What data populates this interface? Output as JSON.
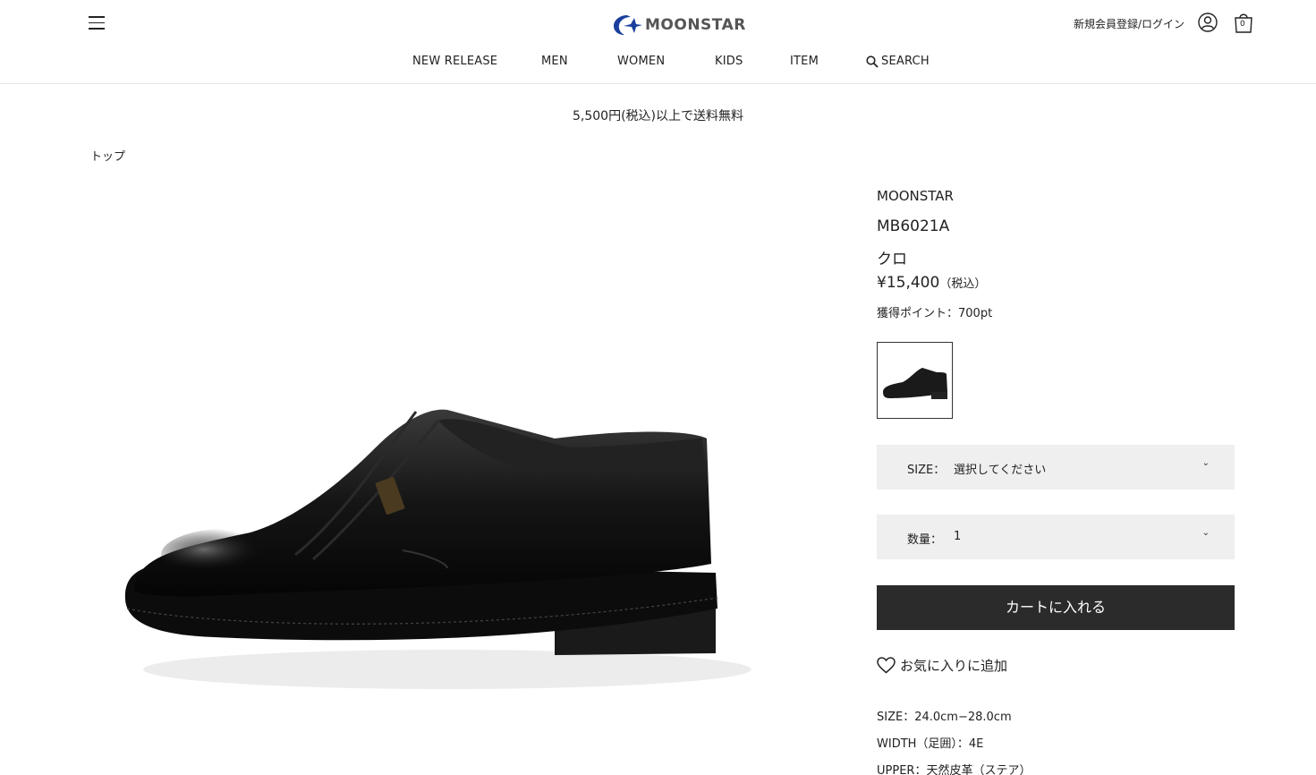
{
  "header": {
    "logo_text": "MOONSTAR",
    "login_label": "新規会員登録/ログイン",
    "cart_count": "0",
    "nav": [
      "NEW RELEASE",
      "MEN",
      "WOMEN",
      "KIDS",
      "ITEM",
      "SEARCH"
    ]
  },
  "notice": "5,500円(税込)以上で送料無料",
  "breadcrumb": "トップ",
  "product": {
    "brand": "MOONSTAR",
    "model": "MB6021A",
    "color": "クロ",
    "price": "¥15,400",
    "tax_note": "（税込）",
    "points": "獲得ポイント：700pt",
    "size_label": "SIZE：",
    "size_value": "選択してください",
    "qty_label": "数量：",
    "qty_value": "1",
    "cart_button": "カートに入れる",
    "favorite": "お気に入りに追加",
    "specs": [
      "SIZE：24.0cm−28.0cm",
      "WIDTH（足囲）：4E",
      "UPPER：天然皮革（ステア）"
    ]
  },
  "colors": {
    "cart_button_bg": "#2b2b2b",
    "select_bg": "#efefef",
    "logo_blue": "#1a3f9c"
  },
  "icons": [
    "hamburger-icon",
    "user-icon",
    "cart-icon",
    "search-icon",
    "heart-icon",
    "chevron-down-icon"
  ]
}
